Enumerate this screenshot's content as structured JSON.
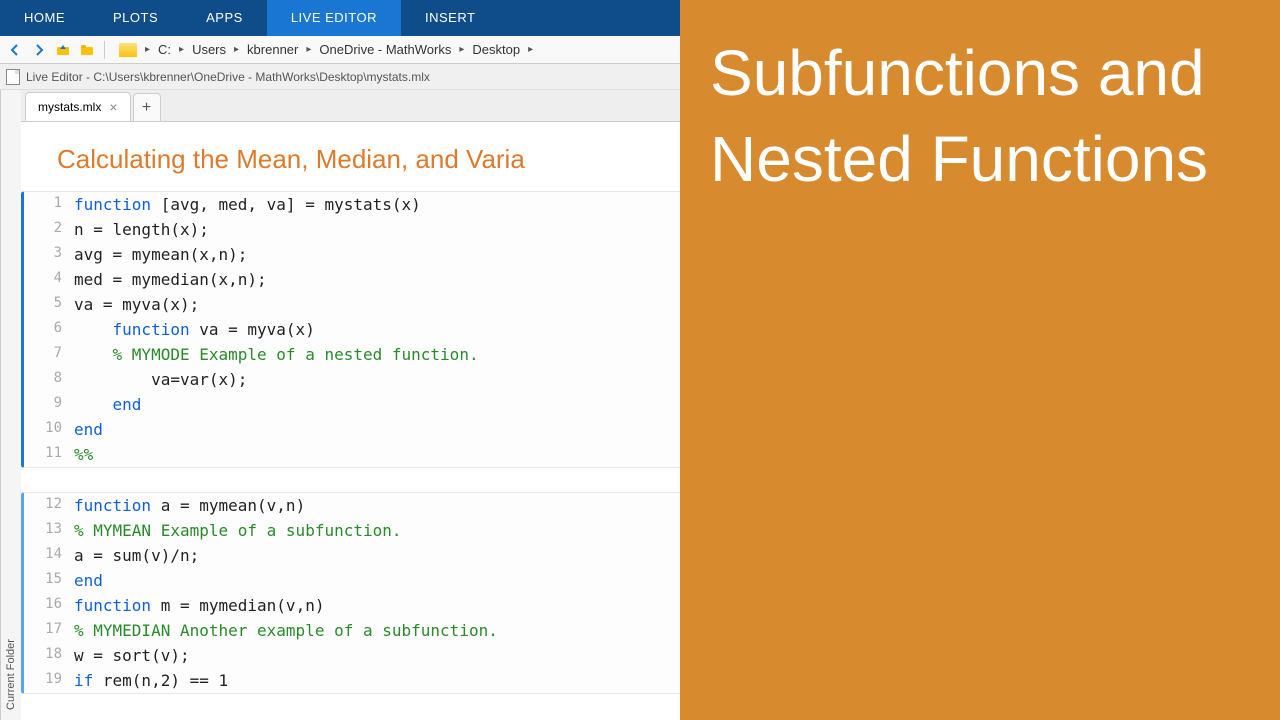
{
  "ribbon": {
    "tabs": [
      "HOME",
      "PLOTS",
      "APPS",
      "LIVE EDITOR",
      "INSERT"
    ],
    "active_index": 3
  },
  "breadcrumb": [
    "C:",
    "Users",
    "kbrenner",
    "OneDrive - MathWorks",
    "Desktop"
  ],
  "titlebar": "Live Editor - C:\\Users\\kbrenner\\OneDrive - MathWorks\\Desktop\\mystats.mlx",
  "side_panel": "Current Folder",
  "file_tab": "mystats.mlx",
  "heading": "Calculating the Mean, Median, and Varia",
  "code_block1": [
    {
      "n": 1,
      "html": "<span class='kw'>function</span> [avg, med, va] = <span class='fn'>mystats</span>(x)"
    },
    {
      "n": 2,
      "html": "n = length(x);"
    },
    {
      "n": 3,
      "html": "avg = mymean(x,n);"
    },
    {
      "n": 4,
      "html": "med = mymedian(x,n);"
    },
    {
      "n": 5,
      "html": "va = myva(x);"
    },
    {
      "n": 6,
      "html": "    <span class='kw'>function</span> va = <span class='fn'>myva</span>(x)"
    },
    {
      "n": 7,
      "html": "    <span class='cm'>% MYMODE Example of a nested function.</span>"
    },
    {
      "n": 8,
      "html": "        va=var(x);"
    },
    {
      "n": 9,
      "html": "    <span class='kw'>end</span>"
    },
    {
      "n": 10,
      "html": "<span class='kw'>end</span>"
    },
    {
      "n": 11,
      "html": "<span class='cm'>%%</span>"
    }
  ],
  "code_block2": [
    {
      "n": 12,
      "html": "<span class='kw'>function</span> a = <span class='fn'>mymean</span>(v,n)"
    },
    {
      "n": 13,
      "html": "<span class='cm'>% MYMEAN Example of a subfunction.</span>"
    },
    {
      "n": 14,
      "html": "a = sum(v)/n;"
    },
    {
      "n": 15,
      "html": "<span class='kw'>end</span>"
    },
    {
      "n": 16,
      "html": "<span class='kw'>function</span> m = <span class='fn'>mymedian</span>(v,n)"
    },
    {
      "n": 17,
      "html": "<span class='cm'>% MYMEDIAN Another example of a subfunction.</span>"
    },
    {
      "n": 18,
      "html": "w = sort(v);"
    },
    {
      "n": 19,
      "html": "<span class='kw'>if</span> rem(n,2) == 1"
    }
  ],
  "overlay": "Subfunctions and Nested Functions"
}
